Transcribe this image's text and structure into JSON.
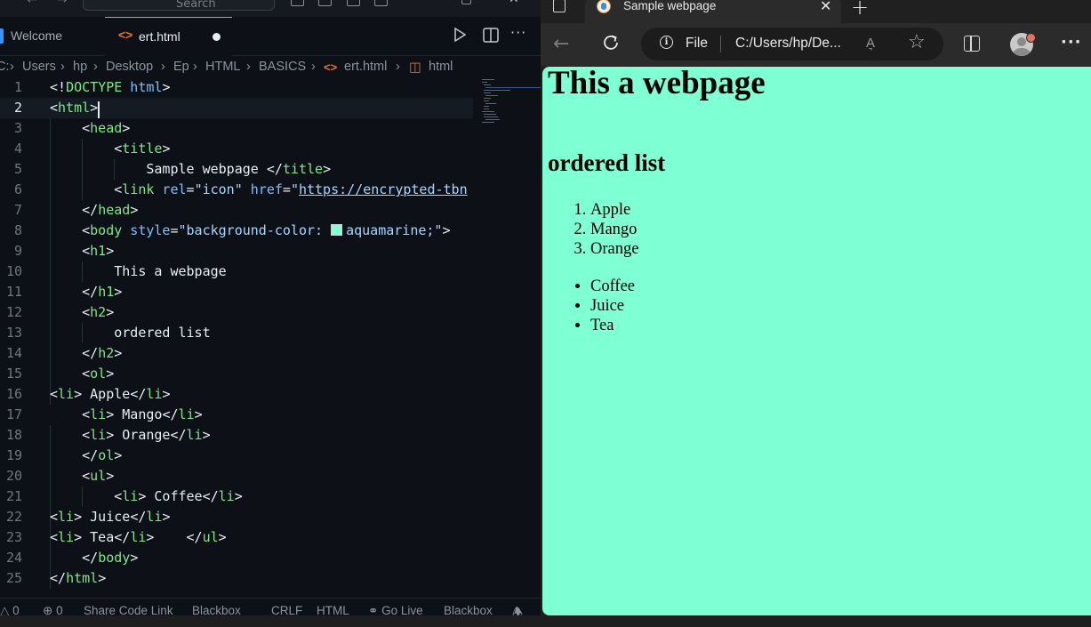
{
  "editor": {
    "search_placeholder": "Search",
    "tabs": [
      {
        "label": "Welcome"
      },
      {
        "label": "ert.html"
      }
    ],
    "breadcrumb": [
      "C:",
      "Users",
      "hp",
      "Desktop",
      "Ep",
      "HTML",
      "BASICS",
      "ert.html",
      "html"
    ],
    "line_numbers": [
      "1",
      "2",
      "3",
      "4",
      "5",
      "6",
      "7",
      "8",
      "9",
      "10",
      "11",
      "12",
      "13",
      "14",
      "15",
      "16",
      "17",
      "18",
      "19",
      "20",
      "21",
      "22",
      "23",
      "24",
      "25"
    ],
    "current_line": "2",
    "code": {
      "l1_a": "<!",
      "l1_b": "DOCTYPE",
      "l1_c": " html",
      "l1_d": ">",
      "l2_a": "<",
      "l2_b": "html",
      "l2_c": ">",
      "l3_b": "head",
      "l4_b": "title",
      "l5_text": "Sample webpage ",
      "l5_b": "title",
      "l6_b": "link",
      "l6_attr1": " rel",
      "l6_val1": "\"icon\"",
      "l6_attr2": " href",
      "l6_q": "\"",
      "l6_url": "https://encrypted-tbn",
      "l7_b": "head",
      "l8_b": "body",
      "l8_attr": " style",
      "l8_val": "\"background-color: ",
      "l8_color": "aquamarine;\"",
      "l9_b": "h1",
      "l10_text": "This a webpage",
      "l11_b": "h1",
      "l12_b": "h2",
      "l13_text": "ordered list",
      "l14_b": "h2",
      "l15_b": "ol",
      "l16_b": "li",
      "l16_text": " Apple",
      "l17_b": "li",
      "l17_text": " Mango",
      "l18_b": "li",
      "l18_text": " Orange",
      "l19_b": "ol",
      "l20_b": "ul",
      "l21_b": "li",
      "l21_text": " Coffee",
      "l22_b": "li",
      "l22_text": " Juice",
      "l23_b": "li",
      "l23_text": " Tea",
      "l23_b2": "ul",
      "l24_b": "body",
      "l25_b": "html"
    },
    "status": {
      "errors": "0",
      "warnings": "0",
      "share": "Share Code Link",
      "blackbox1": "Blackbox",
      "eol": "CRLF",
      "language": "HTML",
      "golive": "Go Live",
      "blackbox2": "Blackbox"
    }
  },
  "browser": {
    "tab_title": "Sample webpage",
    "address_scheme": "File",
    "address_url": "C:/Users/hp/De...",
    "read_aloud": "A͉",
    "page": {
      "background_color": "#7fffd4",
      "h1": "This a webpage",
      "h2": "ordered list",
      "ordered_items": [
        "Apple",
        "Mango",
        "Orange"
      ],
      "unordered_items": [
        "Coffee",
        "Juice",
        "Tea"
      ]
    }
  },
  "colors": {
    "editor_bg": "#0d1117",
    "tag_green": "#7ee787",
    "attr_blue": "#79c0ff",
    "aquamarine": "#7fffd4"
  }
}
